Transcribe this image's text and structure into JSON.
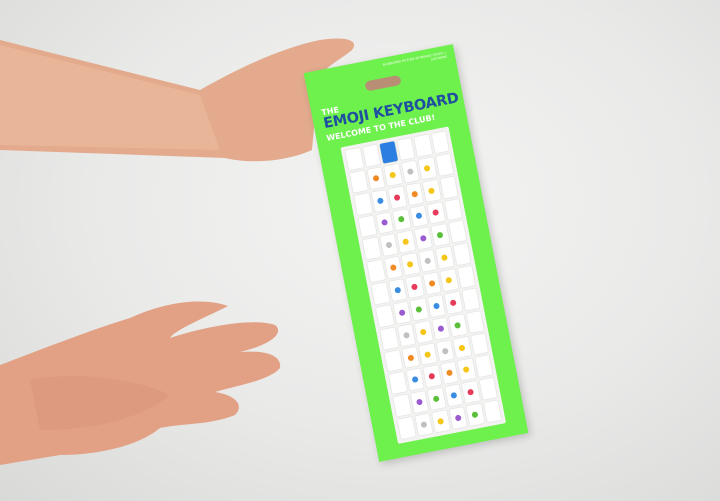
{
  "package": {
    "fine_print": "BLUEBOARD PICTURE KEYBOARD STICKS + SOFTWARE",
    "overline": "THE",
    "title": "EMOJI KEYBOARD",
    "tagline": "WELCOME TO THE CLUB!",
    "colors": {
      "package": "#6ef04d",
      "title": "#1f4fa0",
      "background": "#ececeb",
      "skin": "#e0a58a"
    }
  }
}
